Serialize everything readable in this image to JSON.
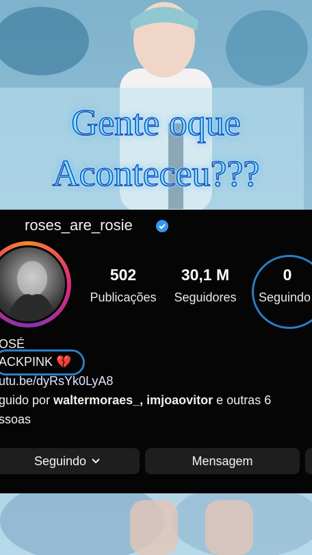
{
  "caption": {
    "line1": "Gente oque",
    "line2": "Aconteceu???"
  },
  "profile": {
    "username": "roses_are_rosie",
    "stats": [
      {
        "value": "502",
        "label": "Publicações"
      },
      {
        "value": "30,1 M",
        "label": "Seguidores"
      },
      {
        "value": "0",
        "label": "Seguindo"
      }
    ],
    "bio": {
      "name": "OSÉ",
      "group": "ACKPINK",
      "group_emoji": "💔",
      "link": "utu.be/dyRsYk0LyA8",
      "followed_prefix": "guido por ",
      "followed_users": "waltermoraes_, imjoaovitor",
      "followed_suffix": " e outras 6",
      "followed_line2": "ssoas"
    },
    "buttons": {
      "following_label": "Seguindo",
      "message_label": "Mensagem"
    }
  },
  "colors": {
    "verified": "#3797f0",
    "annotation_circle": "#2a7fc6",
    "caption_fill": "#7fe8ff",
    "caption_stroke": "#1d4fb8",
    "panel_bg": "#050505"
  }
}
